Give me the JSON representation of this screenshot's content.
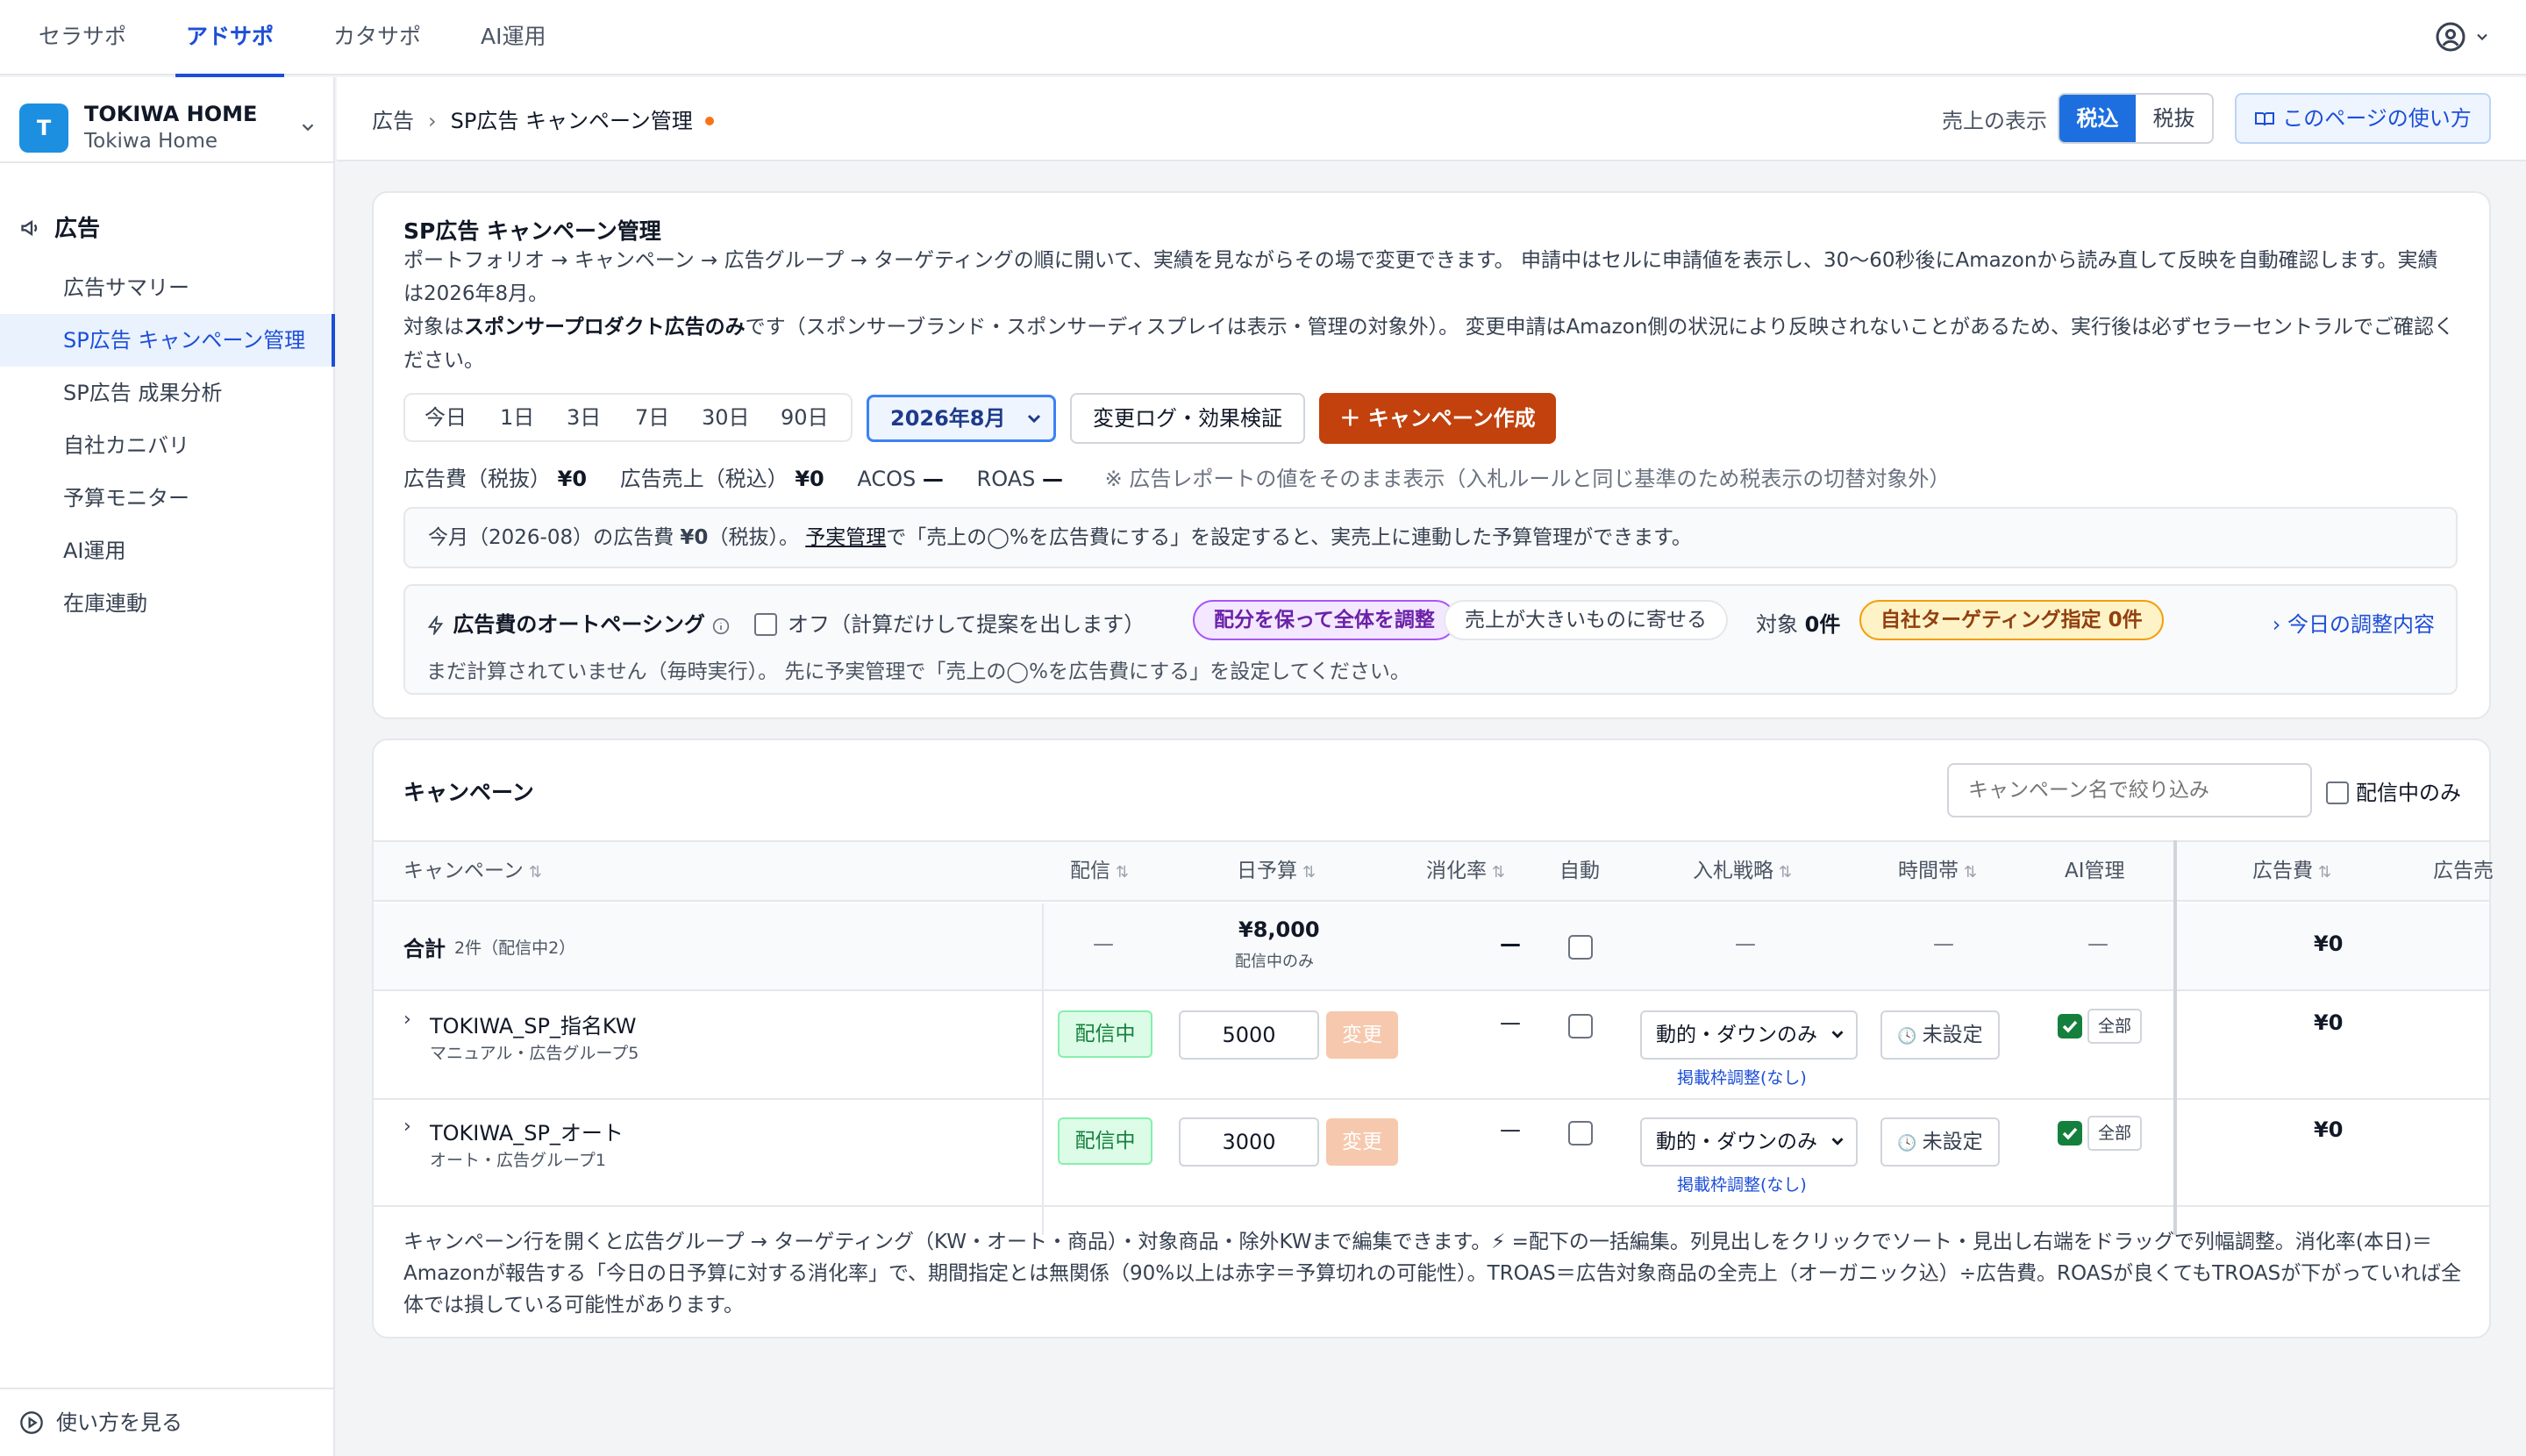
{
  "topnav": {
    "tabs": [
      {
        "label": "セラサポ",
        "active": false
      },
      {
        "label": "アドサポ",
        "active": true
      },
      {
        "label": "カタサポ",
        "active": false
      },
      {
        "label": "AI運用",
        "active": false
      }
    ],
    "user_icon": "user-circle-icon"
  },
  "sidebar": {
    "logo_letter": "T",
    "account_name": "TOKIWA HOME",
    "account_sub": "Tokiwa Home",
    "section": "広告",
    "items": [
      {
        "label": "広告サマリー",
        "active": false
      },
      {
        "label": "SP広告 キャンペーン管理",
        "active": true
      },
      {
        "label": "SP広告 成果分析",
        "active": false
      },
      {
        "label": "自社カニバリ",
        "active": false
      },
      {
        "label": "予算モニター",
        "active": false
      },
      {
        "label": "AI運用",
        "active": false
      },
      {
        "label": "在庫連動",
        "active": false
      }
    ],
    "help": "使い方を見る"
  },
  "header": {
    "crumb_root": "広告",
    "crumb_current": "SP広告 キャンペーン管理",
    "sales_display_label": "売上の表示",
    "tax_in": "税込",
    "tax_out": "税抜",
    "howto": "このページの使い方",
    "accent": "#1d6fe0"
  },
  "panel": {
    "title": "SP広告 キャンペーン管理",
    "desc1": "ポートフォリオ → キャンペーン → 広告グループ → ターゲティングの順に開いて、実績を見ながらその場で変更できます。 申請中はセルに申請値を表示し、30〜60秒後にAmazonから読み直して反映を自動確認します。実績は2026年8月。",
    "desc2_pre": "対象は",
    "desc2_bold": "スポンサープロダクト広告のみ",
    "desc2_post": "です（スポンサーブランド・スポンサーディスプレイは表示・管理の対象外）。 変更申請はAmazon側の状況により反映されないことがあるため、実行後は必ずセラーセントラルでご確認ください。",
    "ranges": [
      "今日",
      "1日",
      "3日",
      "7日",
      "30日",
      "90日"
    ],
    "month": "2026年8月",
    "log_button": "変更ログ・効果検証",
    "create_button": "＋ キャンペーン作成",
    "create_color": "#c2410c",
    "metrics": {
      "spend_label": "広告費（税抜）",
      "spend": "¥0",
      "sales_label": "広告売上（税込）",
      "sales": "¥0",
      "acos_label": "ACOS",
      "acos": "—",
      "roas_label": "ROAS",
      "roas": "—",
      "note": "※ 広告レポートの値をそのまま表示（入札ルールと同じ基準のため税表示の切替対象外）"
    },
    "budget_note": {
      "pre": "今月（2026-08）の広告費 ",
      "amount": "¥0",
      "mid": "（税抜）。 ",
      "link": "予実管理",
      "post": "で「売上の◯%を広告費にする」を設定すると、実売上に連動した予算管理ができます。"
    },
    "autopace": {
      "title": "広告費のオートペーシング",
      "off_label": "オフ（計算だけして提案を出します）",
      "mode1": "配分を保って全体を調整",
      "mode2": "売上が大きいものに寄せる",
      "target_label": "対象",
      "target_count": "0件",
      "self_target": "自社ターゲティング指定 0件",
      "today_link": "今日の調整内容",
      "message": "まだ計算されていません（毎時実行）。 先に予実管理で「売上の◯%を広告費にする」を設定してください。"
    }
  },
  "campaigns": {
    "title": "キャンペーン",
    "search_placeholder": "キャンペーン名で絞り込み",
    "only_active": "配信中のみ",
    "columns": {
      "name": "キャンペーン",
      "delivery": "配信",
      "budget": "日予算",
      "consumption": "消化率",
      "auto": "自動",
      "bid": "入札戦略",
      "time": "時間帯",
      "ai": "AI管理",
      "spend": "広告費",
      "sales": "広告売"
    },
    "total": {
      "label": "合計",
      "count": "2件（配信中2）",
      "delivery": "—",
      "budget": "¥8,000",
      "budget_note": "配信中のみ",
      "consumption": "—",
      "bid": "—",
      "time": "—",
      "ai": "—",
      "spend": "¥0"
    },
    "rows": [
      {
        "name": "TOKIWA_SP_指名KW",
        "sub": "マニュアル・広告グループ5",
        "status": "配信中",
        "budget": "5000",
        "change": "変更",
        "consumption": "—",
        "bid": "動的・ダウンのみ",
        "bid_link": "掲載枠調整(なし)",
        "time": "未設定",
        "ai_tag": "全部",
        "spend": "¥0"
      },
      {
        "name": "TOKIWA_SP_オート",
        "sub": "オート・広告グループ1",
        "status": "配信中",
        "budget": "3000",
        "change": "変更",
        "consumption": "—",
        "bid": "動的・ダウンのみ",
        "bid_link": "掲載枠調整(なし)",
        "time": "未設定",
        "ai_tag": "全部",
        "spend": "¥0"
      }
    ],
    "footnote": "キャンペーン行を開くと広告グループ → ターゲティング（KW・オート・商品）・対象商品・除外KWまで編集できます。⚡ =配下の一括編集。列見出しをクリックでソート・見出し右端をドラッグで列幅調整。消化率(本日)＝Amazonが報告する「今日の日予算に対する消化率」で、期間指定とは無関係（90%以上は赤字＝予算切れの可能性）。TROAS＝広告対象商品の全売上（オーガニック込）÷広告費。ROASが良くてもTROASが下がっていれば全体では損している可能性があります。"
  }
}
